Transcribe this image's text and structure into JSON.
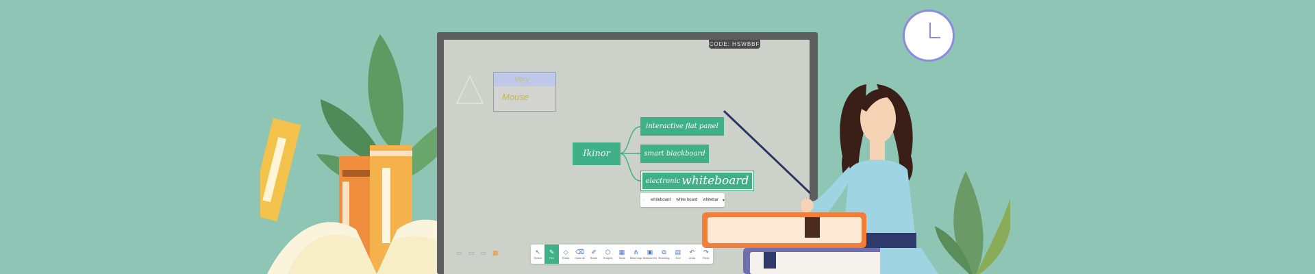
{
  "screen": {
    "code_label": "CODE: HSWBBF",
    "image_card": {
      "line1": "Very",
      "line2": "Mouse"
    }
  },
  "mindmap": {
    "root": "Ikinor",
    "children": [
      {
        "label": "interactive flat panel"
      },
      {
        "label": "smart blackboard"
      },
      {
        "label_prefix": "electronic",
        "label_main": "whiteboard"
      }
    ]
  },
  "suggestions": {
    "lead_icon": "close-icon",
    "options": [
      "whiteboard",
      "white board",
      "whitebar"
    ]
  },
  "toolbar": {
    "tools": [
      {
        "id": "select",
        "label": "Select",
        "icon": "↖",
        "active": false
      },
      {
        "id": "pen",
        "label": "Pen",
        "icon": "✎",
        "active": true
      },
      {
        "id": "eraser",
        "label": "Erase",
        "icon": "◇",
        "active": false
      },
      {
        "id": "clear",
        "label": "Clear all",
        "icon": "⌫",
        "active": false
      },
      {
        "id": "brush",
        "label": "Brush",
        "icon": "✐",
        "active": false
      },
      {
        "id": "shapes",
        "label": "Shapes",
        "icon": "⬡",
        "active": false
      },
      {
        "id": "table",
        "label": "Table",
        "icon": "▦",
        "active": false
      },
      {
        "id": "mindmap",
        "label": "Mind map",
        "icon": "⋔",
        "active": false
      },
      {
        "id": "multiscreen",
        "label": "Multiscreen",
        "icon": "▣",
        "active": false
      },
      {
        "id": "roaming",
        "label": "Roaming",
        "icon": "⧉",
        "active": false
      },
      {
        "id": "toolbox",
        "label": "Tool",
        "icon": "▤",
        "active": false
      },
      {
        "id": "undo",
        "label": "Undo",
        "icon": "↶",
        "active": false
      },
      {
        "id": "redo",
        "label": "Redo",
        "icon": "↷",
        "active": false
      }
    ]
  },
  "colors": {
    "background": "#8fc5b4",
    "accent": "#3fb088",
    "screen": "#ccd1c9"
  }
}
